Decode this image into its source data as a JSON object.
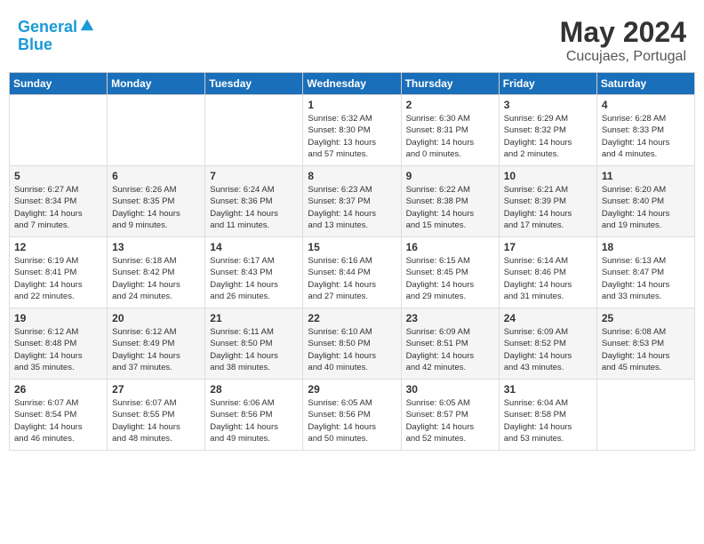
{
  "logo": {
    "line1": "General",
    "line2": "Blue"
  },
  "title": "May 2024",
  "location": "Cucujaes, Portugal",
  "weekdays": [
    "Sunday",
    "Monday",
    "Tuesday",
    "Wednesday",
    "Thursday",
    "Friday",
    "Saturday"
  ],
  "weeks": [
    [
      {
        "day": "",
        "content": ""
      },
      {
        "day": "",
        "content": ""
      },
      {
        "day": "",
        "content": ""
      },
      {
        "day": "1",
        "content": "Sunrise: 6:32 AM\nSunset: 8:30 PM\nDaylight: 13 hours\nand 57 minutes."
      },
      {
        "day": "2",
        "content": "Sunrise: 6:30 AM\nSunset: 8:31 PM\nDaylight: 14 hours\nand 0 minutes."
      },
      {
        "day": "3",
        "content": "Sunrise: 6:29 AM\nSunset: 8:32 PM\nDaylight: 14 hours\nand 2 minutes."
      },
      {
        "day": "4",
        "content": "Sunrise: 6:28 AM\nSunset: 8:33 PM\nDaylight: 14 hours\nand 4 minutes."
      }
    ],
    [
      {
        "day": "5",
        "content": "Sunrise: 6:27 AM\nSunset: 8:34 PM\nDaylight: 14 hours\nand 7 minutes."
      },
      {
        "day": "6",
        "content": "Sunrise: 6:26 AM\nSunset: 8:35 PM\nDaylight: 14 hours\nand 9 minutes."
      },
      {
        "day": "7",
        "content": "Sunrise: 6:24 AM\nSunset: 8:36 PM\nDaylight: 14 hours\nand 11 minutes."
      },
      {
        "day": "8",
        "content": "Sunrise: 6:23 AM\nSunset: 8:37 PM\nDaylight: 14 hours\nand 13 minutes."
      },
      {
        "day": "9",
        "content": "Sunrise: 6:22 AM\nSunset: 8:38 PM\nDaylight: 14 hours\nand 15 minutes."
      },
      {
        "day": "10",
        "content": "Sunrise: 6:21 AM\nSunset: 8:39 PM\nDaylight: 14 hours\nand 17 minutes."
      },
      {
        "day": "11",
        "content": "Sunrise: 6:20 AM\nSunset: 8:40 PM\nDaylight: 14 hours\nand 19 minutes."
      }
    ],
    [
      {
        "day": "12",
        "content": "Sunrise: 6:19 AM\nSunset: 8:41 PM\nDaylight: 14 hours\nand 22 minutes."
      },
      {
        "day": "13",
        "content": "Sunrise: 6:18 AM\nSunset: 8:42 PM\nDaylight: 14 hours\nand 24 minutes."
      },
      {
        "day": "14",
        "content": "Sunrise: 6:17 AM\nSunset: 8:43 PM\nDaylight: 14 hours\nand 26 minutes."
      },
      {
        "day": "15",
        "content": "Sunrise: 6:16 AM\nSunset: 8:44 PM\nDaylight: 14 hours\nand 27 minutes."
      },
      {
        "day": "16",
        "content": "Sunrise: 6:15 AM\nSunset: 8:45 PM\nDaylight: 14 hours\nand 29 minutes."
      },
      {
        "day": "17",
        "content": "Sunrise: 6:14 AM\nSunset: 8:46 PM\nDaylight: 14 hours\nand 31 minutes."
      },
      {
        "day": "18",
        "content": "Sunrise: 6:13 AM\nSunset: 8:47 PM\nDaylight: 14 hours\nand 33 minutes."
      }
    ],
    [
      {
        "day": "19",
        "content": "Sunrise: 6:12 AM\nSunset: 8:48 PM\nDaylight: 14 hours\nand 35 minutes."
      },
      {
        "day": "20",
        "content": "Sunrise: 6:12 AM\nSunset: 8:49 PM\nDaylight: 14 hours\nand 37 minutes."
      },
      {
        "day": "21",
        "content": "Sunrise: 6:11 AM\nSunset: 8:50 PM\nDaylight: 14 hours\nand 38 minutes."
      },
      {
        "day": "22",
        "content": "Sunrise: 6:10 AM\nSunset: 8:50 PM\nDaylight: 14 hours\nand 40 minutes."
      },
      {
        "day": "23",
        "content": "Sunrise: 6:09 AM\nSunset: 8:51 PM\nDaylight: 14 hours\nand 42 minutes."
      },
      {
        "day": "24",
        "content": "Sunrise: 6:09 AM\nSunset: 8:52 PM\nDaylight: 14 hours\nand 43 minutes."
      },
      {
        "day": "25",
        "content": "Sunrise: 6:08 AM\nSunset: 8:53 PM\nDaylight: 14 hours\nand 45 minutes."
      }
    ],
    [
      {
        "day": "26",
        "content": "Sunrise: 6:07 AM\nSunset: 8:54 PM\nDaylight: 14 hours\nand 46 minutes."
      },
      {
        "day": "27",
        "content": "Sunrise: 6:07 AM\nSunset: 8:55 PM\nDaylight: 14 hours\nand 48 minutes."
      },
      {
        "day": "28",
        "content": "Sunrise: 6:06 AM\nSunset: 8:56 PM\nDaylight: 14 hours\nand 49 minutes."
      },
      {
        "day": "29",
        "content": "Sunrise: 6:05 AM\nSunset: 8:56 PM\nDaylight: 14 hours\nand 50 minutes."
      },
      {
        "day": "30",
        "content": "Sunrise: 6:05 AM\nSunset: 8:57 PM\nDaylight: 14 hours\nand 52 minutes."
      },
      {
        "day": "31",
        "content": "Sunrise: 6:04 AM\nSunset: 8:58 PM\nDaylight: 14 hours\nand 53 minutes."
      },
      {
        "day": "",
        "content": ""
      }
    ]
  ]
}
